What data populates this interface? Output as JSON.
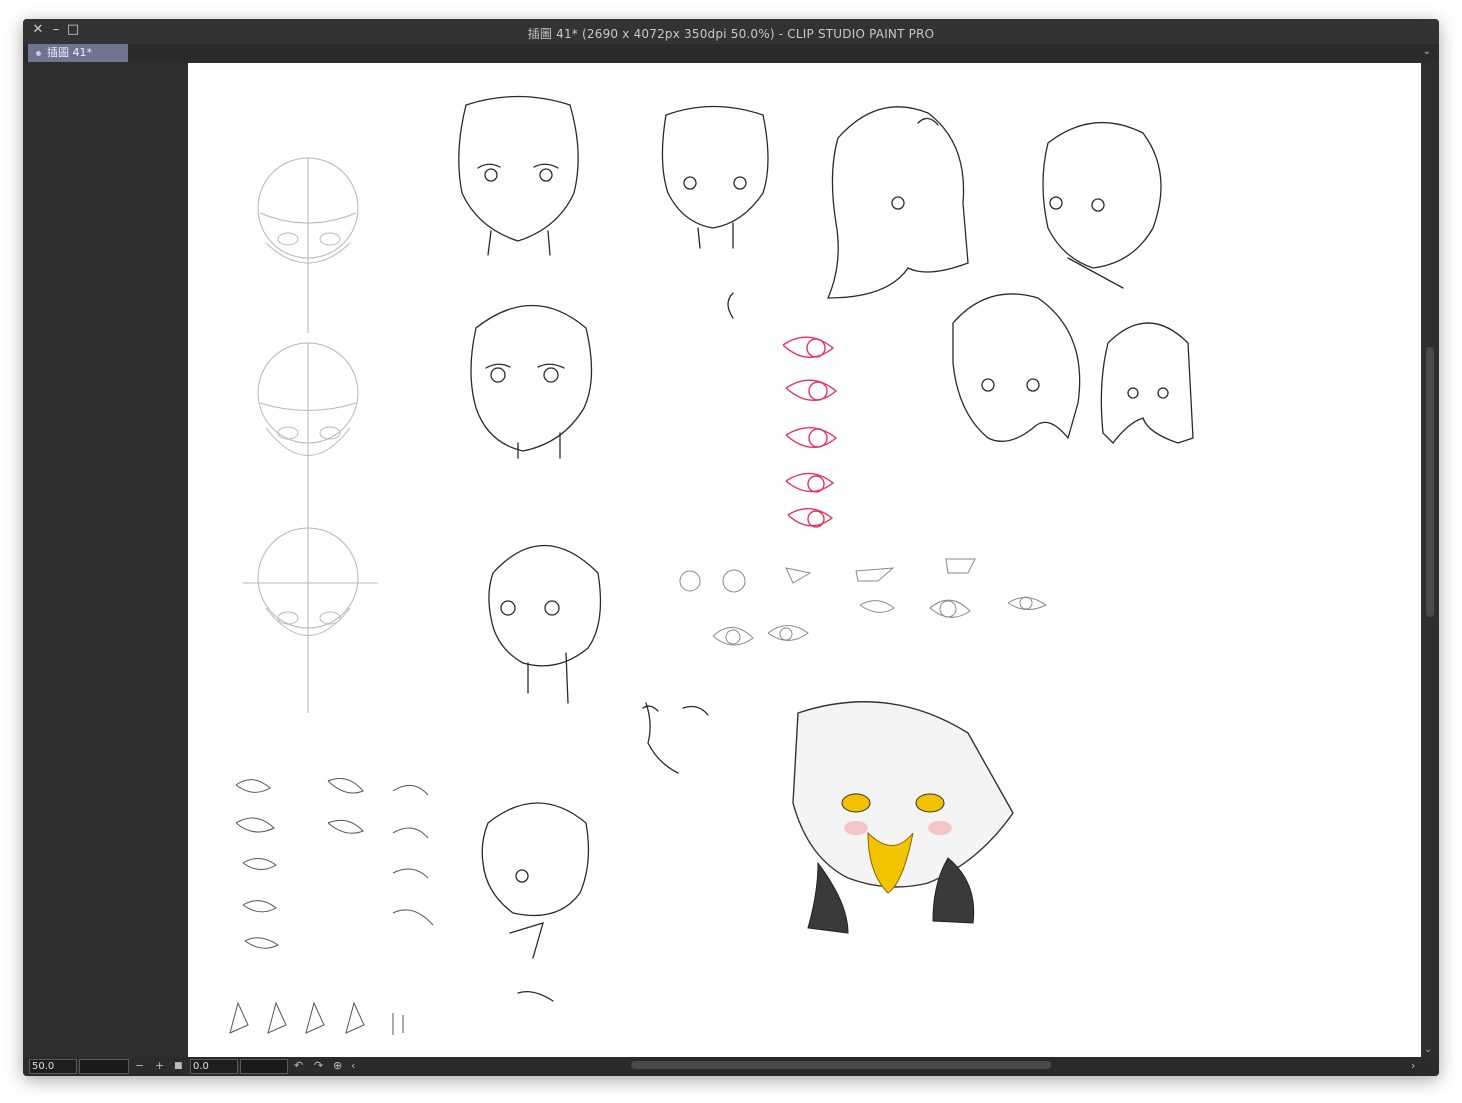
{
  "window": {
    "title": "插圖 41* (2690 x 4072px 350dpi 50.0%)  - CLIP STUDIO PAINT PRO",
    "controls": [
      "close-icon",
      "minimize-icon",
      "maximize-icon"
    ]
  },
  "tabs": [
    {
      "label": "插圖 41*",
      "active": true
    }
  ],
  "statusbar": {
    "zoom_value": "50.0",
    "rotation_value": "0.0",
    "zoom_out": "−",
    "zoom_in": "+",
    "fit": "■"
  },
  "icons": {
    "close": "✕",
    "minimize": "–",
    "maximize": "□",
    "chevron": "⌄",
    "rotate_left": "↶",
    "rotate_right": "↷",
    "reset": "⊕",
    "scroll_left": "‹",
    "scroll_right": "›"
  },
  "colors": {
    "window_bg": "#2e2e2e",
    "tab_active": "#6f7590",
    "canvas": "#ffffff",
    "eye_red": "#e8345a",
    "eye_yellow": "#f2c200"
  }
}
